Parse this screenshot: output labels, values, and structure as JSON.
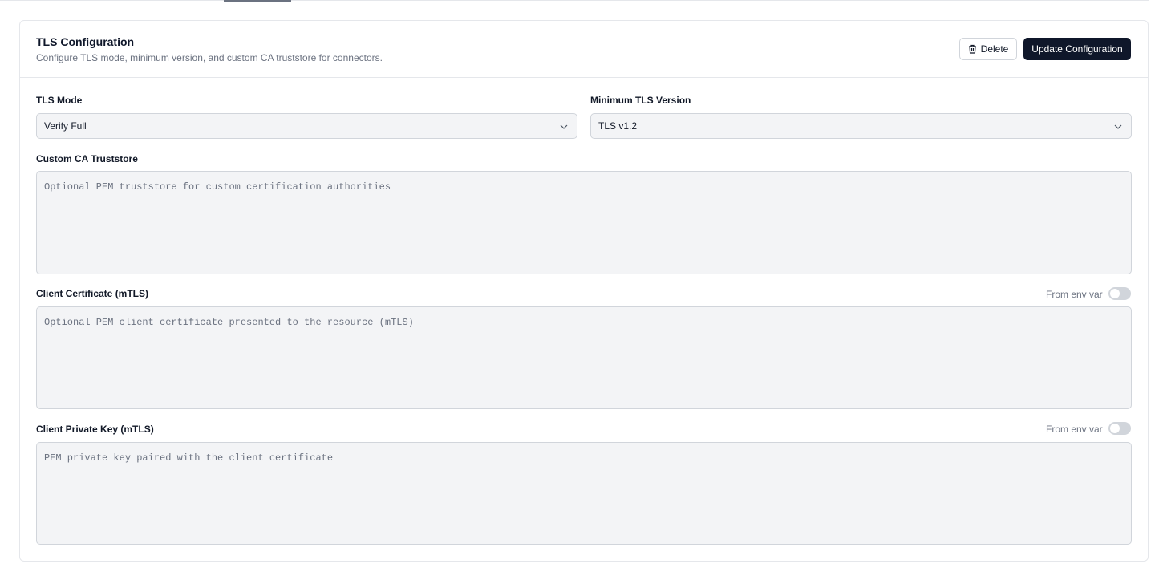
{
  "card": {
    "title": "TLS Configuration",
    "description": "Configure TLS mode, minimum version, and custom CA truststore for connectors.",
    "delete_label": "Delete",
    "update_label": "Update Configuration"
  },
  "fields": {
    "tls_mode": {
      "label": "TLS Mode",
      "value": "Verify Full"
    },
    "min_version": {
      "label": "Minimum TLS Version",
      "value": "TLS v1.2"
    },
    "ca_truststore": {
      "label": "Custom CA Truststore",
      "placeholder": "Optional PEM truststore for custom certification authorities",
      "value": ""
    },
    "client_cert": {
      "label": "Client Certificate (mTLS)",
      "placeholder": "Optional PEM client certificate presented to the resource (mTLS)",
      "value": "",
      "env_label": "From env var",
      "env_enabled": false
    },
    "client_key": {
      "label": "Client Private Key (mTLS)",
      "placeholder": "PEM private key paired with the client certificate",
      "value": "",
      "env_label": "From env var",
      "env_enabled": false
    }
  },
  "icons": {
    "delete": "trash-icon",
    "dropdown": "chevron-down-icon"
  },
  "colors": {
    "primary": "#0f172a",
    "field_bg": "#f3f4f6",
    "border": "#d1d5db",
    "muted_text": "#6b7280"
  }
}
